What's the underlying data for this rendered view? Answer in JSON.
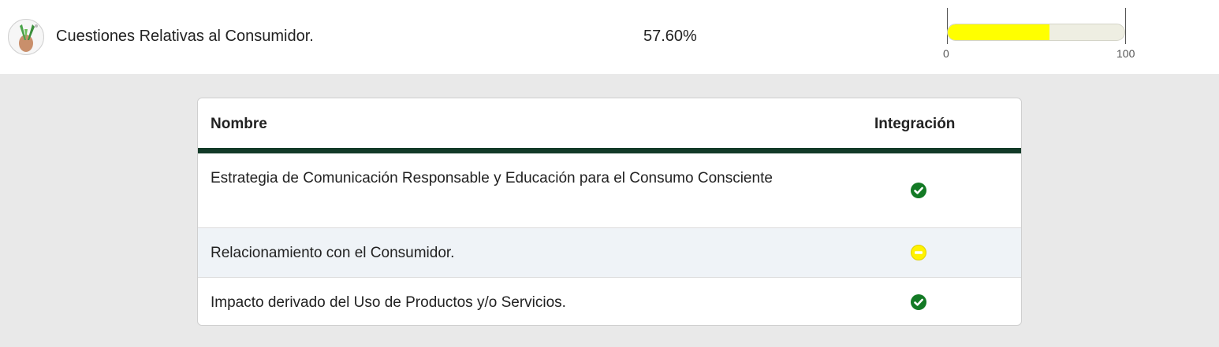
{
  "summary": {
    "title": "Cuestiones Relativas al Consumidor.",
    "percentage": "57.60%",
    "gauge": {
      "value": 57.6,
      "min_label": "0",
      "max_label": "100",
      "fill_color": "#ffff00"
    }
  },
  "table": {
    "headers": {
      "name": "Nombre",
      "integration": "Integración"
    },
    "header_bar_color": "#123a28",
    "rows": [
      {
        "name": "Estrategia de Comunicación Responsable y Educación para el Consumo Consciente",
        "status": "check-circle-icon"
      },
      {
        "name": "Relacionamiento con el Consumidor.",
        "status": "minus-circle-icon"
      },
      {
        "name": "Impacto derivado del Uso de Productos y/o Servicios.",
        "status": "check-circle-icon"
      }
    ]
  }
}
